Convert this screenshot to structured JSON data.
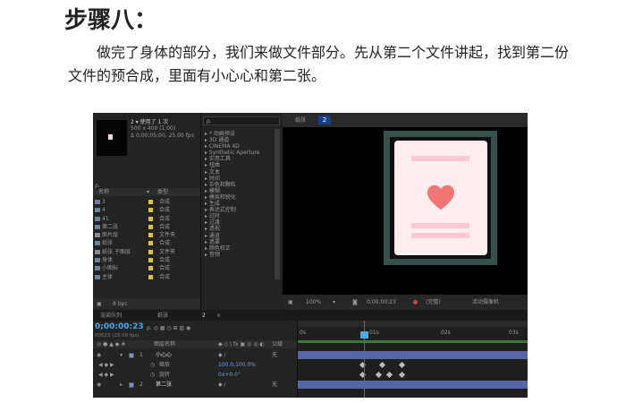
{
  "article": {
    "heading": "步骤八：",
    "paragraph": "做完了身体的部分，我们来做文件部分。先从第二个文件讲起，找到第二份文件的预合成，里面有小心心和第二张。"
  },
  "project_panel": {
    "comp_name": "2 ▾ 使用了 1 次",
    "comp_size": "500 x 400 (1.00)",
    "comp_duration": "Δ 0;00;05;00, 25.00 fps",
    "search_placeholder": "ρ.",
    "col_name": "名称",
    "col_type": "类型",
    "rows": [
      {
        "name": "3",
        "type": "合成"
      },
      {
        "name": "4",
        "type": "合成"
      },
      {
        "name": "41",
        "type": "合成"
      },
      {
        "name": "第二张",
        "type": "合成"
      },
      {
        "name": "图片层",
        "type": "文件夹"
      },
      {
        "name": "纸张",
        "type": "合成"
      },
      {
        "name": "纸张 子图层",
        "type": "文件夹"
      },
      {
        "name": "身体",
        "type": "合成"
      },
      {
        "name": "小图标",
        "type": "合成"
      },
      {
        "name": "主体",
        "type": "合成"
      }
    ],
    "bpc": "8 bpc"
  },
  "effects_panel": {
    "search_placeholder": "ρ.",
    "items": [
      "▸ * 动画预设",
      "▸ 3D 通道",
      "▸ CINEMA 4D",
      "▸ Synthetic Aperture",
      "▸ 实用工具",
      "▸ 扭曲",
      "▸ 文本",
      "▸ 时间",
      "▸ 杂色和颗粒",
      "▸ 模糊",
      "▸ 模拟和锐化",
      "▸ 生成",
      "▸ 表达式控制",
      "▸ 过时",
      "▸ 过渡",
      "▸ 透视",
      "▸ 通道",
      "▸ 遮罩",
      "▸ 颜色校正",
      "▸ 音频"
    ]
  },
  "viewer": {
    "tab_label": "纸张",
    "tab_badge": "2",
    "zoom": "100%",
    "timecode": "0;00;00;23",
    "channel": "(完整)",
    "camera": "活动摄像机",
    "colors": {
      "frame": "#34514d",
      "card": "#ffeef1",
      "bars": "#fbc8d3",
      "heart": "#f27473"
    }
  },
  "timeline": {
    "tabs": [
      "渲染队列",
      "纸张",
      "2"
    ],
    "timecode": "0;00:00:23",
    "subtime": "00023 (25.00 fps)",
    "header_name": "图层名称",
    "header_parent": "父级",
    "layers": [
      {
        "num": "1",
        "name": "小心心",
        "parent": "无"
      },
      {
        "prop": "缩放",
        "value": "100.0,100.0%"
      },
      {
        "prop": "旋转",
        "value": "0x+0.0°"
      },
      {
        "num": "2",
        "name": "第二张",
        "parent": "无"
      }
    ],
    "ruler_labels": [
      "0s",
      "01s",
      "02s",
      "03s"
    ]
  }
}
